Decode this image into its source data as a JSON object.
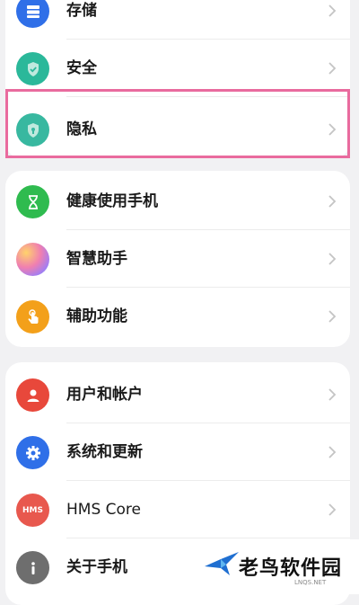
{
  "group1": {
    "items": [
      {
        "label": "存储",
        "icon": "storage-icon",
        "color": "#2f6fe8"
      },
      {
        "label": "安全",
        "icon": "shield-check-icon",
        "color": "#2bb89a"
      },
      {
        "label": "隐私",
        "icon": "privacy-shield-icon",
        "color": "#38b8a0"
      }
    ]
  },
  "group2": {
    "items": [
      {
        "label": "健康使用手机",
        "icon": "hourglass-icon",
        "color": "#2fbb4f"
      },
      {
        "label": "智慧助手",
        "icon": "assistant-orb-icon",
        "color": "#c87be0"
      },
      {
        "label": "辅助功能",
        "icon": "hand-tap-icon",
        "color": "#f3a01a"
      }
    ]
  },
  "group3": {
    "items": [
      {
        "label": "用户和帐户",
        "icon": "user-icon",
        "color": "#e8483b"
      },
      {
        "label": "系统和更新",
        "icon": "gear-icon",
        "color": "#2f6fe8"
      },
      {
        "label": "HMS Core",
        "icon": "hms-icon",
        "color": "#e8584e",
        "badge": "HMS"
      },
      {
        "label": "关于手机",
        "icon": "info-icon",
        "color": "#6e6e6e"
      }
    ]
  },
  "watermark": {
    "text": "老鸟软件园",
    "sub": "LNQS.NET"
  }
}
